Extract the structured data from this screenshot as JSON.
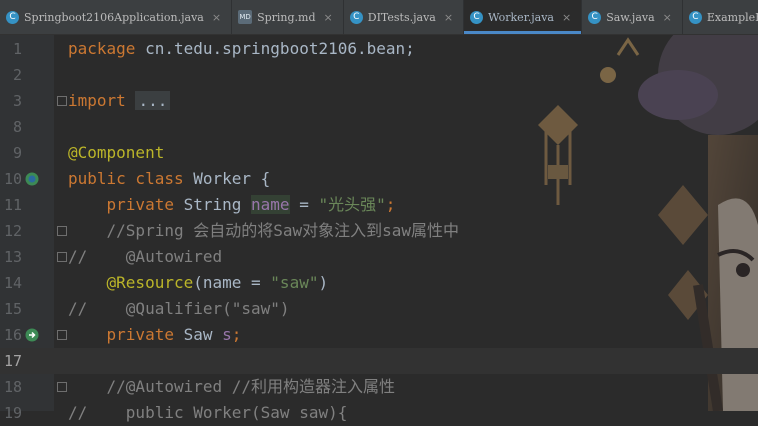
{
  "tabs": [
    {
      "label": "Springboot2106Application.java",
      "icon": "C"
    },
    {
      "label": "Spring.md",
      "icon": "MD"
    },
    {
      "label": "DITests.java",
      "icon": "C"
    },
    {
      "label": "Worker.java",
      "icon": "C"
    },
    {
      "label": "Saw.java",
      "icon": "C"
    },
    {
      "label": "ExampleBean",
      "icon": "C"
    }
  ],
  "close_glyph": "×",
  "lines": {
    "l1": {
      "num": "1",
      "kw": "package",
      "rest": " cn.tedu.springboot2106.bean;"
    },
    "l2": {
      "num": "2"
    },
    "l3": {
      "num": "3",
      "kw": "import",
      "fold": "..."
    },
    "l8": {
      "num": "8"
    },
    "l9": {
      "num": "9",
      "ann": "@Component"
    },
    "l10": {
      "num": "10",
      "kw": "public class",
      "rest": " Worker {"
    },
    "l11": {
      "num": "11",
      "kw": "private",
      "type": " String ",
      "name": "name",
      "eq": " = ",
      "str": "\"光头强\"",
      "end": ";"
    },
    "l12": {
      "num": "12",
      "cmt": "//Spring 会自动的将Saw对象注入到saw属性中"
    },
    "l13": {
      "num": "13",
      "cmt": "//    @Autowired"
    },
    "l14": {
      "num": "14",
      "ann": "@Resource",
      "open": "(name = ",
      "str": "\"saw\"",
      "close": ")"
    },
    "l15": {
      "num": "15",
      "cmt": "//    @Qualifier(\"saw\")"
    },
    "l16": {
      "num": "16",
      "kw": "private",
      "type": " Saw ",
      "fld": "s",
      "end": ";"
    },
    "l17": {
      "num": "17"
    },
    "l18": {
      "num": "18",
      "cmt": "//@Autowired //利用构造器注入属性"
    },
    "l19": {
      "num": "19",
      "cmt": "//    public Worker(Saw saw){"
    }
  },
  "colors": {
    "keyword": "#cc7832",
    "annotation": "#bbb529",
    "string": "#6a8759",
    "field": "#9876aa",
    "comment": "#808080",
    "active_tab_underline": "#4a88c7"
  }
}
